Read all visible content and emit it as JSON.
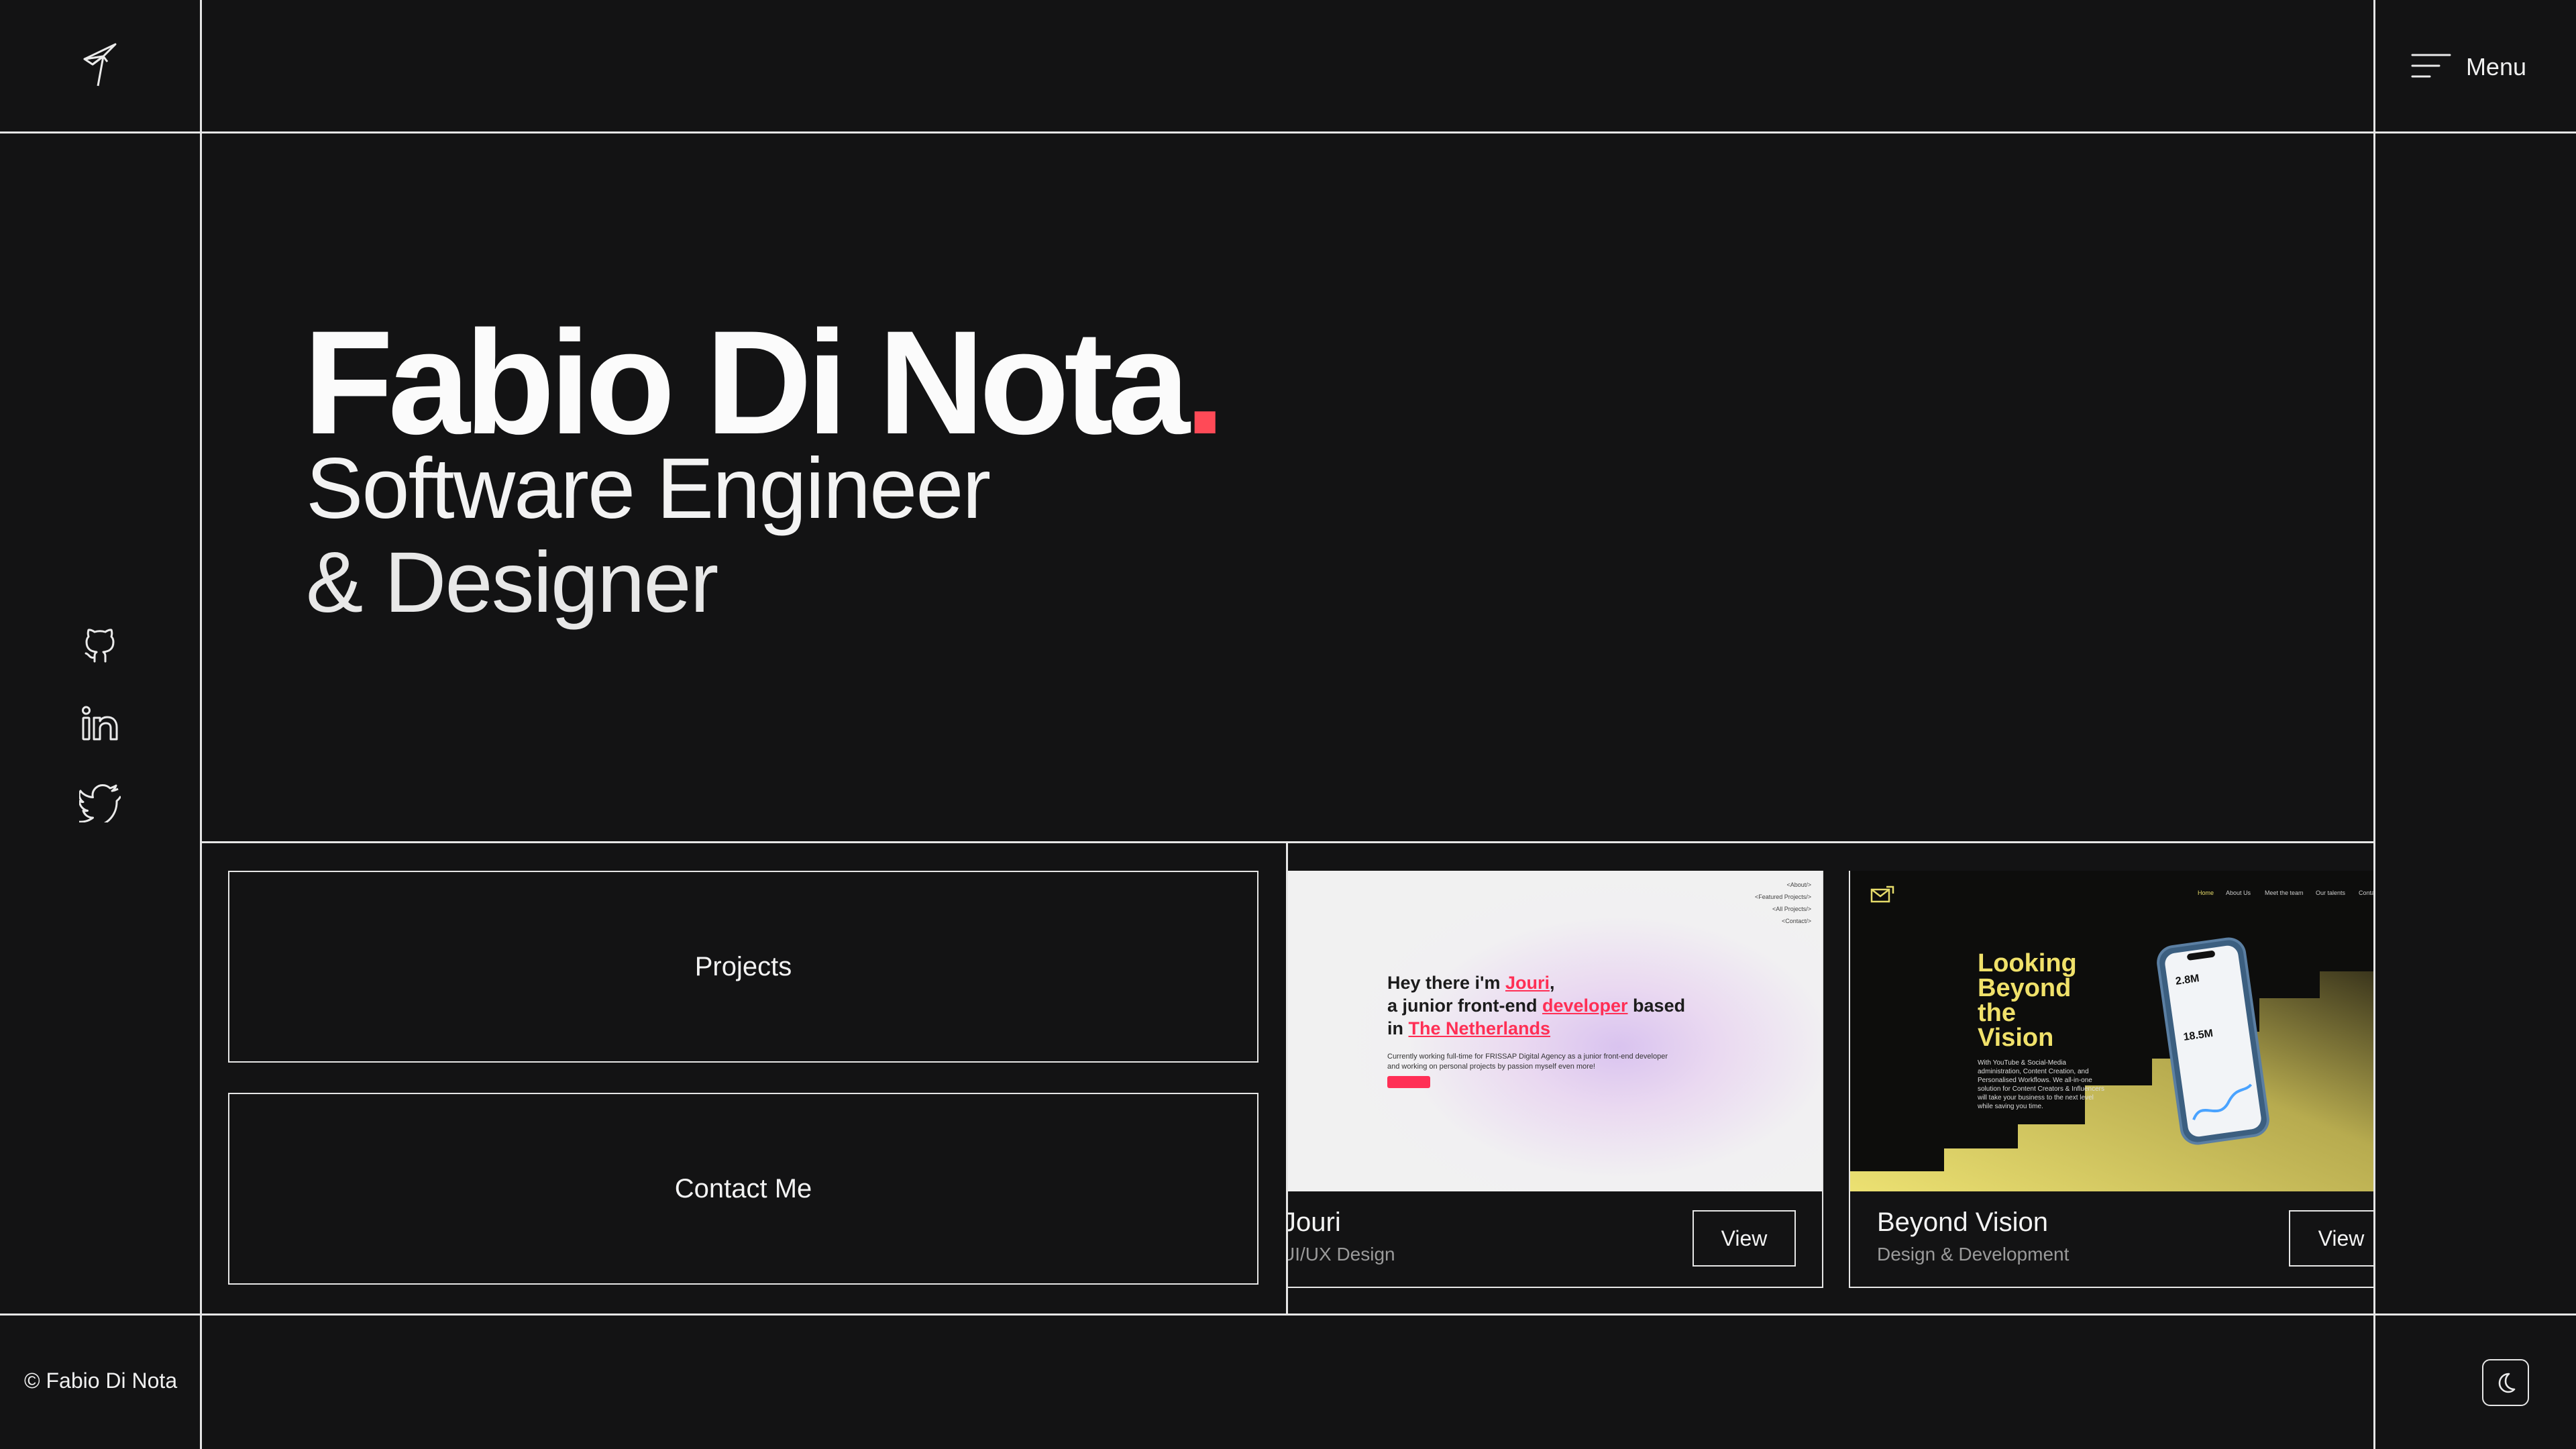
{
  "header": {
    "menu_label": "Menu"
  },
  "hero": {
    "name": "Fabio Di Nota",
    "dot": ".",
    "role_line1": "Software Engineer",
    "role_line2": "& Designer",
    "accent_color": "#ff4a57"
  },
  "social": [
    {
      "name": "github",
      "icon": "github-icon"
    },
    {
      "name": "linkedin",
      "icon": "linkedin-icon"
    },
    {
      "name": "twitter",
      "icon": "twitter-icon"
    }
  ],
  "nav": {
    "projects_label": "Projects",
    "contact_label": "Contact Me"
  },
  "projects": [
    {
      "title": "Jouri",
      "subtitle": "UI/UX Design",
      "view_label": "View",
      "preview": {
        "nav": [
          "<About/>",
          "<Featured Projects/>",
          "<All Projects/>",
          "<Contact/>"
        ],
        "headline_1a": "Hey there i'm ",
        "headline_1b": "Jouri",
        "headline_1c": ",",
        "headline_2a": "a junior front-end ",
        "headline_2b": "developer",
        "headline_2c": " based",
        "headline_3a": "in ",
        "headline_3b": "The Netherlands",
        "body_1": "Currently working full-time for FRISSAP Digital Agency as a junior front-end developer",
        "body_2": "and working on personal projects by passion myself even more!"
      }
    },
    {
      "title": "Beyond Vision",
      "subtitle": "Design & Development",
      "view_label": "View",
      "preview": {
        "nav": [
          "Home",
          "About Us",
          "Meet the team",
          "Our talents",
          "Contact"
        ],
        "headline": [
          "Looking",
          "Beyond",
          "the",
          "Vision"
        ],
        "body": "With YouTube & Social-Media administration, Content Creation, and Personalised Workflows. We all-in-one solution for Content Creators & Influencers will take your business to the next level while saving you time.",
        "stat_1": "2.8M",
        "stat_2": "18.5M",
        "accent_color": "#f0e16a"
      }
    }
  ],
  "footer": {
    "copyright": "© Fabio Di Nota"
  },
  "theme_toggle": {
    "icon": "moon-icon"
  }
}
